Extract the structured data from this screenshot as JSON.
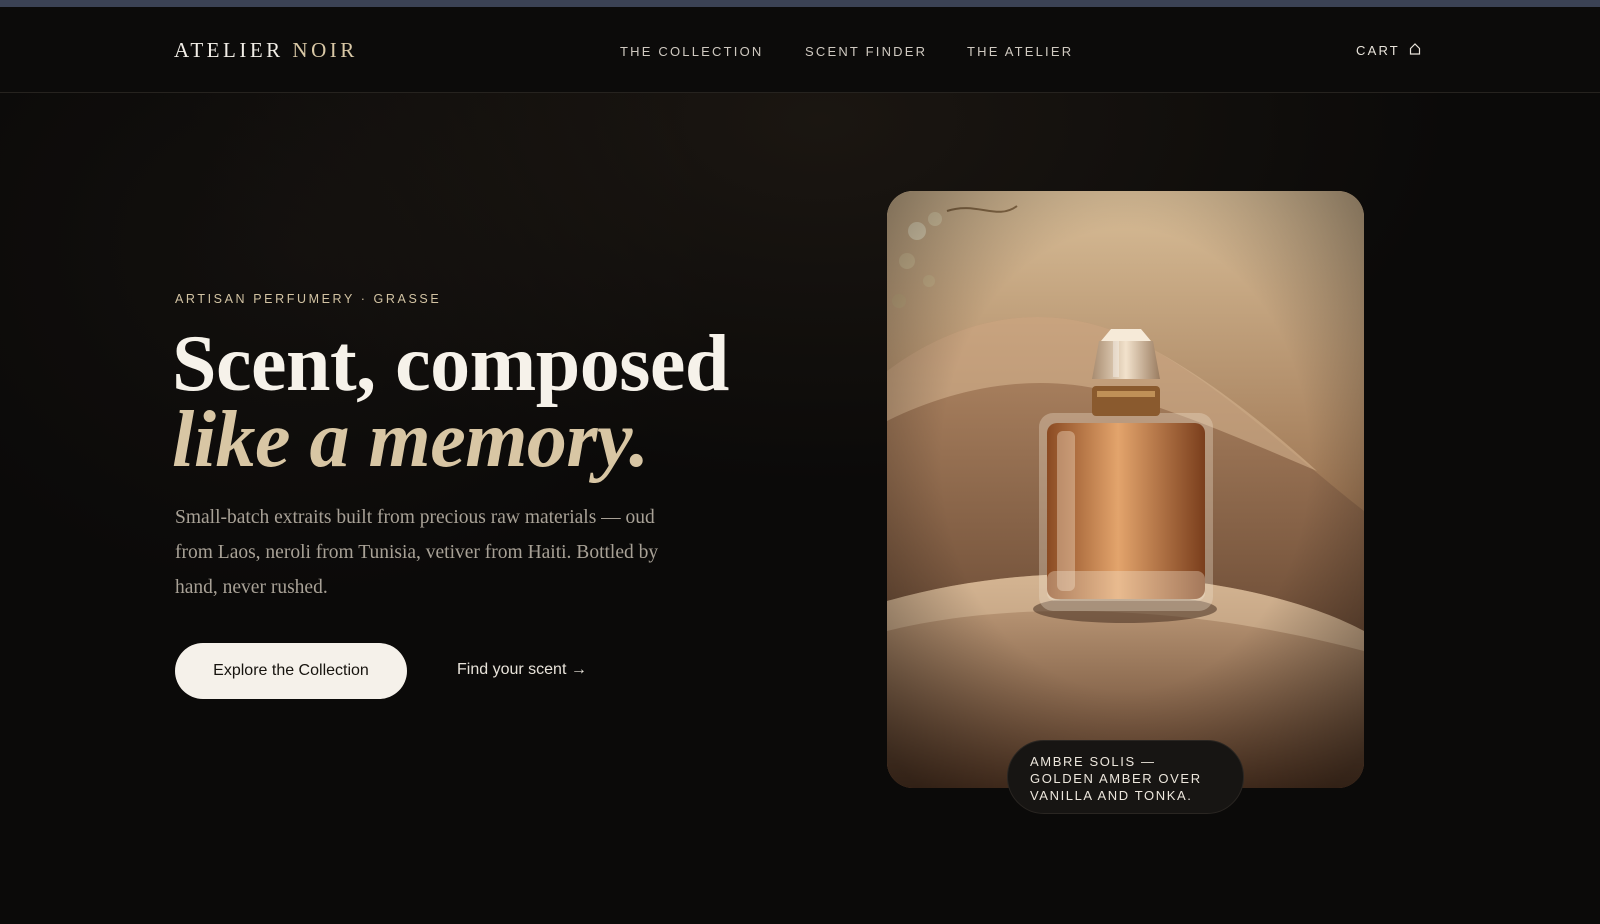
{
  "brand": {
    "name": "ATELIER",
    "accent": "NOIR"
  },
  "nav": {
    "links": [
      "THE COLLECTION",
      "SCENT FINDER",
      "THE ATELIER"
    ],
    "cart_label": "CART",
    "cart_icon": "bag-icon"
  },
  "hero": {
    "eyebrow": "ARTISAN PERFUMERY · GRASSE",
    "headline_line1": "Scent, composed",
    "headline_line2": "like a memory.",
    "lede": "Small-batch extraits built from precious raw materials — oud from Laos, neroli from Tunisia, vetiver from Haiti. Bottled by hand, never rushed.",
    "primary_cta": "Explore the Collection",
    "secondary_cta": "Find your scent →"
  },
  "featured": {
    "caption": "AMBRE SOLIS — GOLDEN AMBER OVER VANILLA AND TONKA."
  },
  "colors": {
    "background": "#0b0a09",
    "accent_gold": "#d8c6a4",
    "text_light": "#f6f2ea",
    "button_bg": "#f5f1ea"
  }
}
